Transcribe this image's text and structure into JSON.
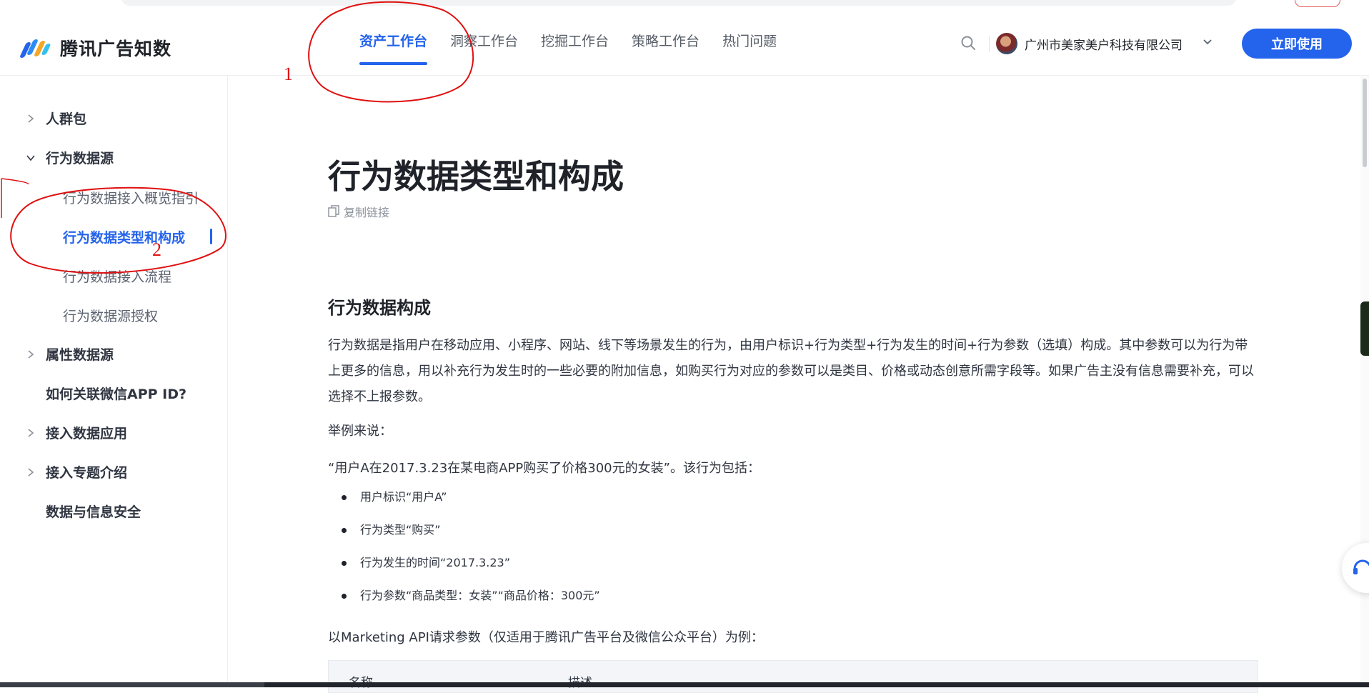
{
  "header": {
    "logo_text": "腾讯广告知数",
    "nav": [
      {
        "label": "资产工作台",
        "active": true
      },
      {
        "label": "洞察工作台",
        "active": false
      },
      {
        "label": "挖掘工作台",
        "active": false
      },
      {
        "label": "策略工作台",
        "active": false
      },
      {
        "label": "热门问题",
        "active": false
      }
    ],
    "account_name": "广州市美家美户科技有限公司",
    "cta_label": "立即使用"
  },
  "sidebar": {
    "items": [
      {
        "label": "人群包",
        "expanded": false
      },
      {
        "label": "行为数据源",
        "expanded": true
      },
      {
        "label": "行为数据接入概览指引"
      },
      {
        "label": "行为数据类型和构成",
        "active": true
      },
      {
        "label": "行为数据接入流程"
      },
      {
        "label": "行为数据源授权"
      },
      {
        "label": "属性数据源",
        "expanded": false
      },
      {
        "label": "如何关联微信APP ID?"
      },
      {
        "label": "接入数据应用",
        "expanded": false
      },
      {
        "label": "接入专题介绍",
        "expanded": false
      },
      {
        "label": "数据与信息安全"
      }
    ]
  },
  "article": {
    "title": "行为数据类型和构成",
    "copy_link": "复制链接",
    "section_title": "行为数据构成",
    "paragraph": "行为数据是指用户在移动应用、小程序、网站、线下等场景发生的行为，由用户标识+行为类型+行为发生的时间+行为参数（选填）构成。其中参数可以为行为带上更多的信息，用以补充行为发生时的一些必要的附加信息，如购买行为对应的参数可以是类目、价格或动态创意所需字段等。如果广告主没有信息需要补充，可以选择不上报参数。",
    "example_intro": "举例来说：",
    "example_sentence": "“用户A在2017.3.23在某电商APP购买了价格300元的女装”。该行为包括：",
    "bullets": [
      "用户标识“用户A”",
      "行为类型“购买”",
      "行为发生的时间“2017.3.23”",
      "行为参数“商品类型：女装”“商品价格：300元”"
    ],
    "api_intro": "以Marketing API请求参数（仅适用于腾讯广告平台及微信公众平台）为例：",
    "table_headers": [
      "名称",
      "描述"
    ]
  },
  "annotations": {
    "mark_1": "1",
    "mark_2": "2",
    "color": "#e01010"
  },
  "colors": {
    "accent": "#2463eb"
  }
}
